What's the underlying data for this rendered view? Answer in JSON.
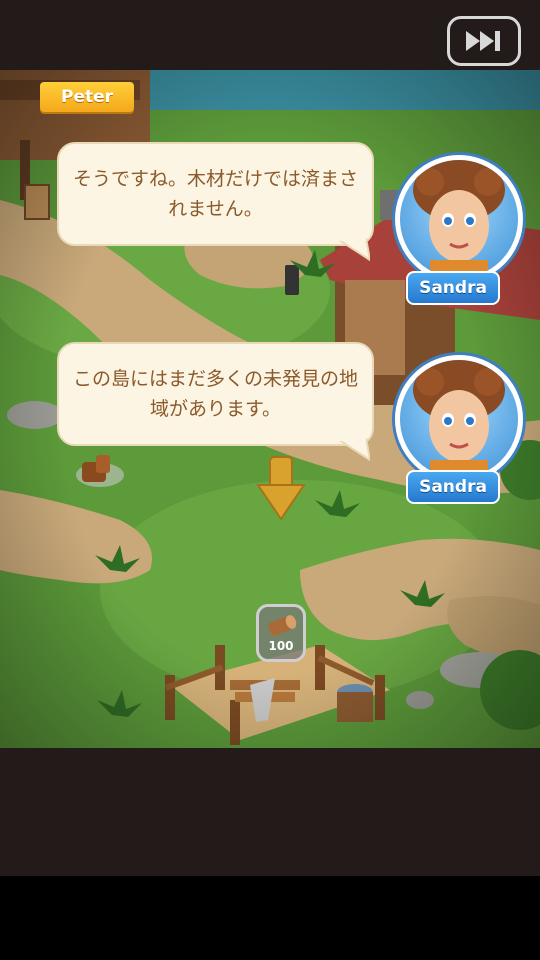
{
  "skip_button": {
    "icon": "fast-forward-icon"
  },
  "speaker_tag": {
    "label": "Peter"
  },
  "dialogs": [
    {
      "text": "そうですね。木材だけでは済まされません。",
      "speaker": "Sandra"
    },
    {
      "text": "この島にはまだ多くの未発見の地域があります。",
      "speaker": "Sandra"
    }
  ],
  "wood_counter": {
    "value": "100",
    "icon": "log-icon"
  },
  "colors": {
    "bar_bg": "#231a1a",
    "grass": "#5c9a3a",
    "path": "#c9a97a",
    "bubble": "#fdf5e4",
    "bubble_text": "#8b5a2b",
    "name_tag": "#f4a81a",
    "char_label": "#2579cf"
  }
}
